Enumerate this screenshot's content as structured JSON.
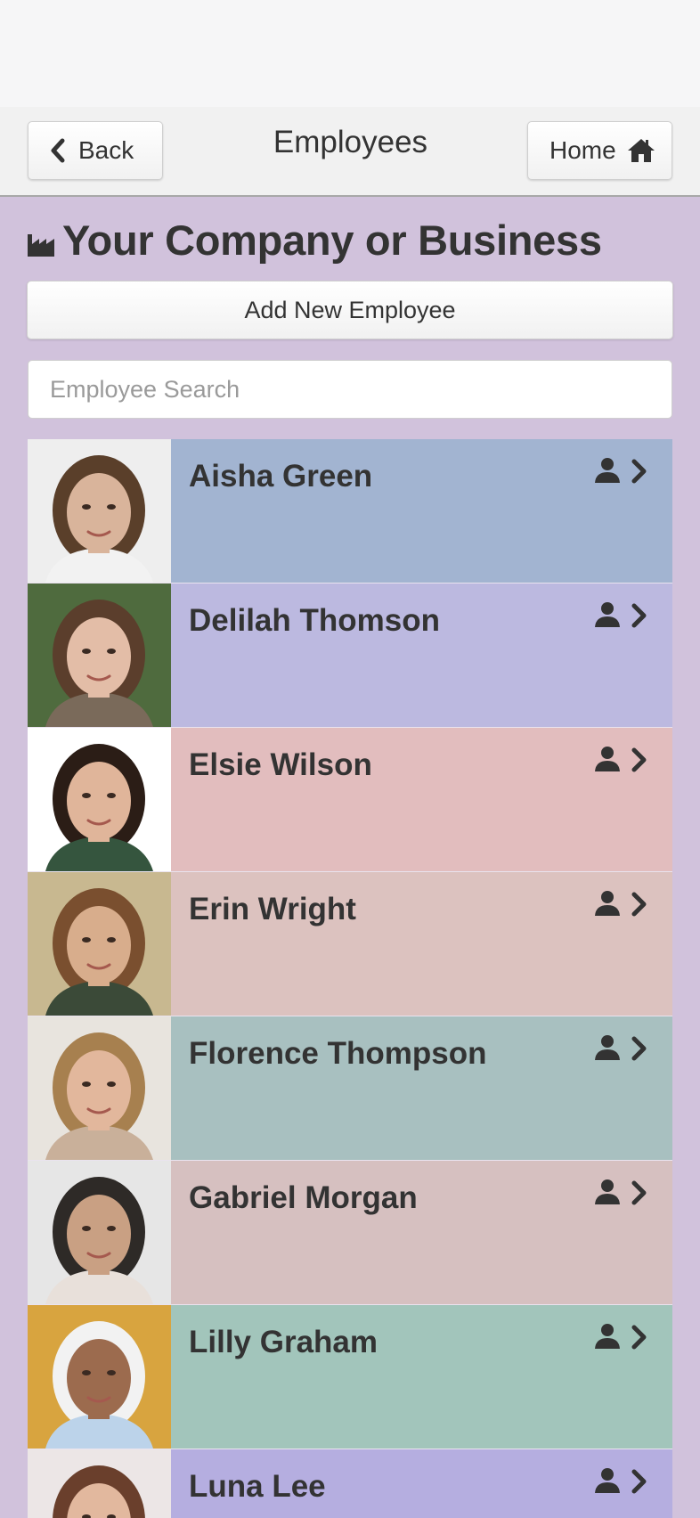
{
  "nav": {
    "back_label": "Back",
    "title": "Employees",
    "home_label": "Home"
  },
  "company": {
    "name": "Your Company or Business",
    "icon": "factory-icon"
  },
  "actions": {
    "add_label": "Add New Employee"
  },
  "search": {
    "placeholder": "Employee Search"
  },
  "employees": [
    {
      "name": "Aisha Green",
      "color": "#a2b4d1"
    },
    {
      "name": "Delilah Thomson",
      "color": "#bcb9e0"
    },
    {
      "name": "Elsie Wilson",
      "color": "#e2bdbe"
    },
    {
      "name": "Erin Wright",
      "color": "#dcc2bf"
    },
    {
      "name": "Florence Thompson",
      "color": "#a8c0c0"
    },
    {
      "name": "Gabriel Morgan",
      "color": "#d6c0c0"
    },
    {
      "name": "Lilly Graham",
      "color": "#a2c5bb"
    },
    {
      "name": "Luna Lee",
      "color": "#b5aee0"
    }
  ],
  "icons": {
    "row_person": "person-icon",
    "row_chevron": "chevron-right-icon"
  }
}
